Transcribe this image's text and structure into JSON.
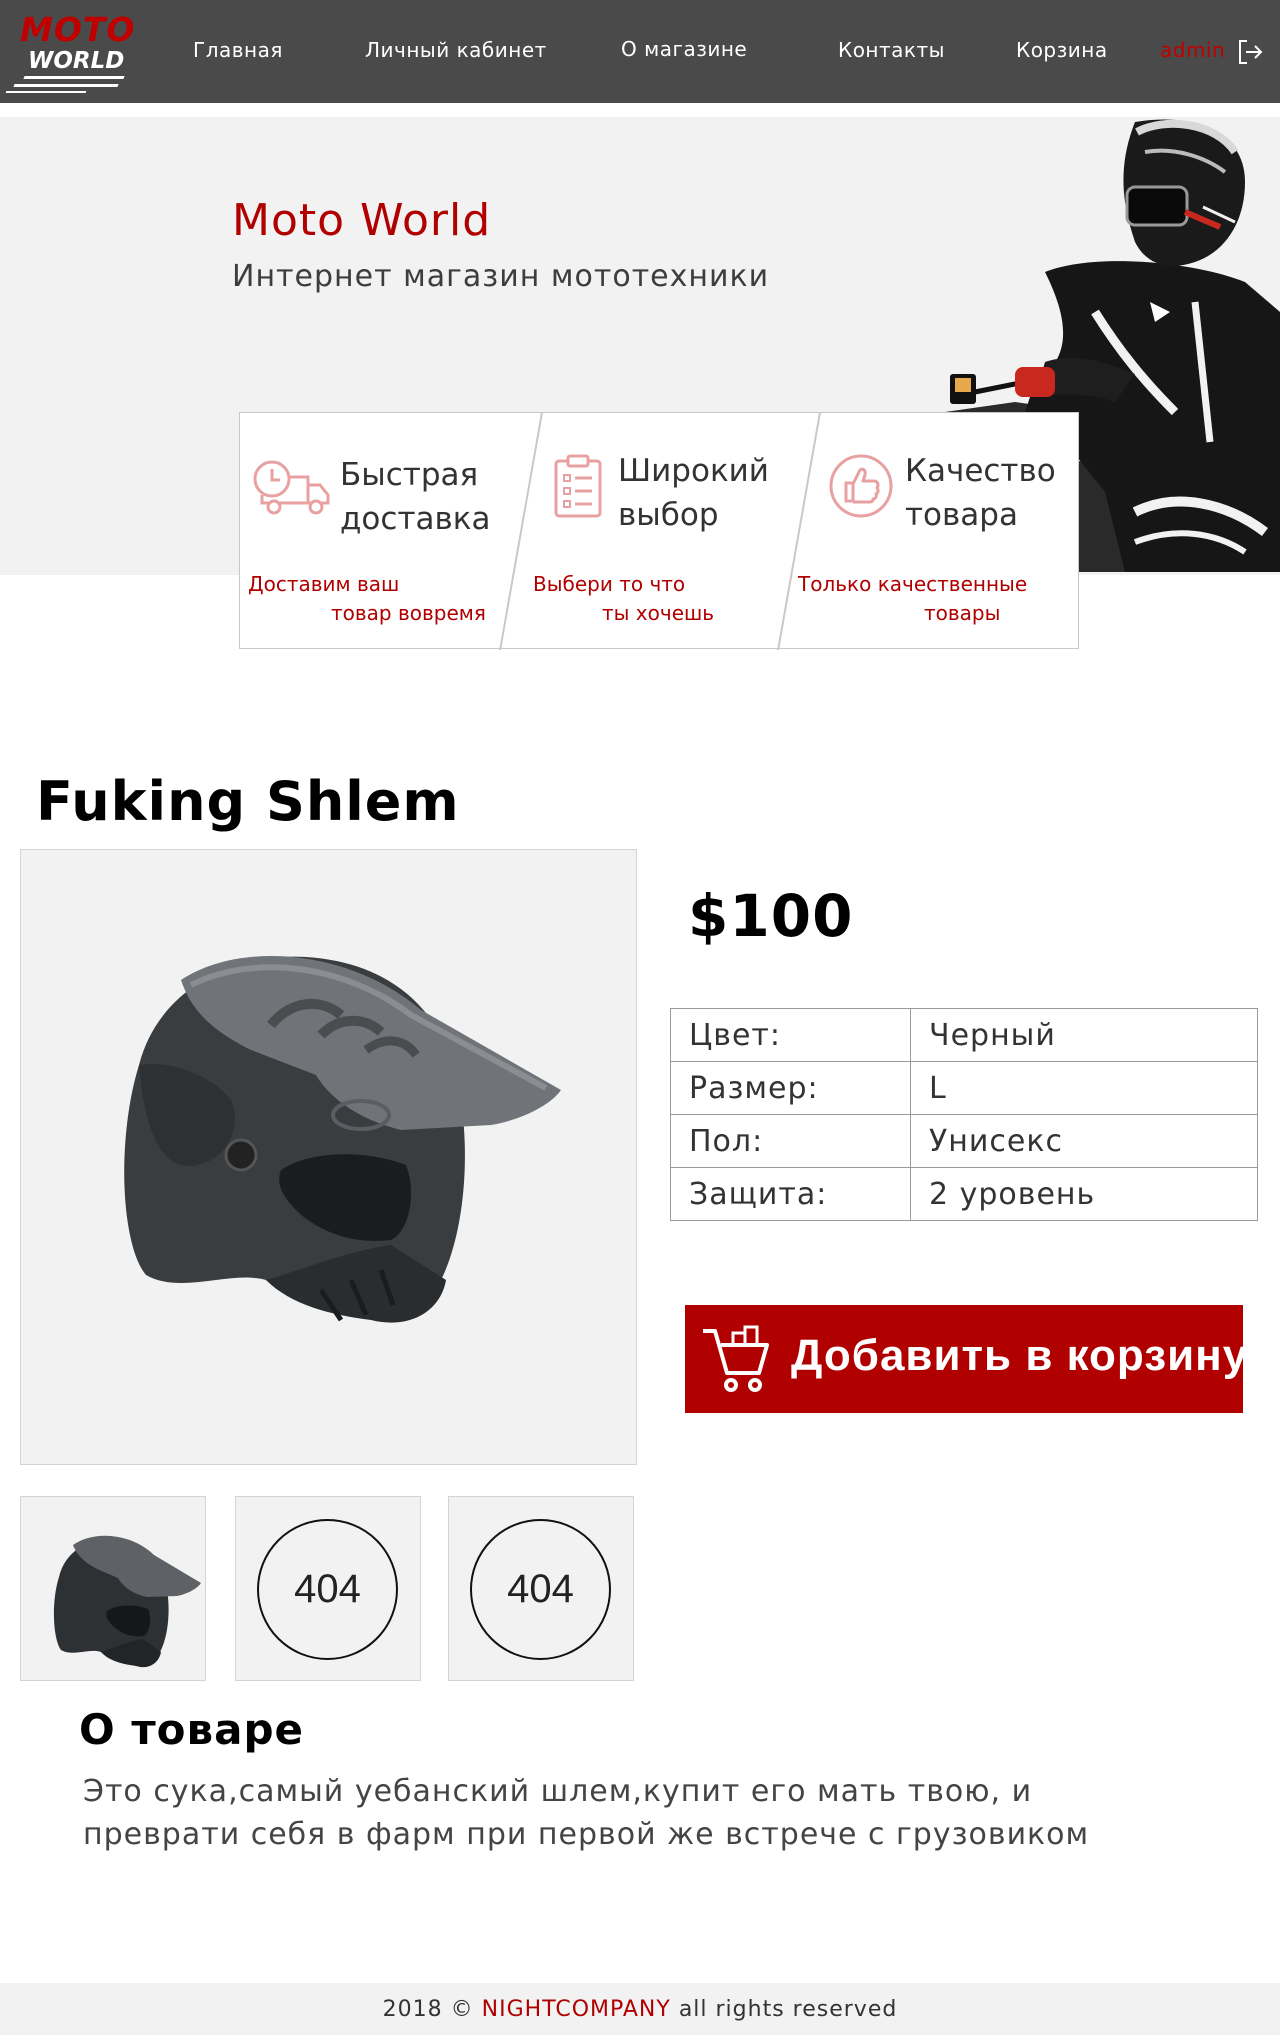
{
  "header": {
    "logo_top": "MOTO",
    "logo_bottom": "WORLD",
    "nav": [
      "Главная",
      "Личный кабинет",
      "О магазине",
      "Контакты",
      "Корзина"
    ],
    "user": "admin",
    "logout_icon": "logout-icon"
  },
  "hero": {
    "title": "Moto World",
    "subtitle": "Интернет магазин мототехники"
  },
  "features": [
    {
      "title_line1": "Быстрая",
      "title_line2": "доставка",
      "desc_line1": "Доставим ваш",
      "desc_line2": "товар вовремя",
      "icon": "delivery-truck-icon"
    },
    {
      "title_line1": "Широкий",
      "title_line2": "выбор",
      "desc_line1": "Выбери то что",
      "desc_line2": "ты хочешь",
      "icon": "checklist-icon"
    },
    {
      "title_line1": "Качество",
      "title_line2": "товара",
      "desc_line1": "Только качественные",
      "desc_line2": "товары",
      "icon": "thumbs-up-icon"
    }
  ],
  "product": {
    "name": "Fuking Shlem",
    "price": "$100",
    "specs": [
      {
        "key": "Цвет:",
        "value": "Черный"
      },
      {
        "key": "Размер:",
        "value": "L"
      },
      {
        "key": "Пол:",
        "value": "Унисекс"
      },
      {
        "key": "Защита:",
        "value": "2 уровень"
      }
    ],
    "thumbs": [
      "404",
      "404"
    ],
    "add_to_cart": "Добавить в корзину",
    "about_title": "О товаре",
    "about_line1": "Это сука,самый уебанский шлем,купит его мать твою, и",
    "about_line2": "преврати себя в фарм при первой же встрече с грузовиком"
  },
  "footer": {
    "prefix": "2018 ©",
    "brand": "NIGHTCOMPANY",
    "suffix": "all rights reserved"
  },
  "colors": {
    "accent": "#b00000",
    "header_bg": "#4a4a4a",
    "panel_bg": "#f2f2f2"
  }
}
